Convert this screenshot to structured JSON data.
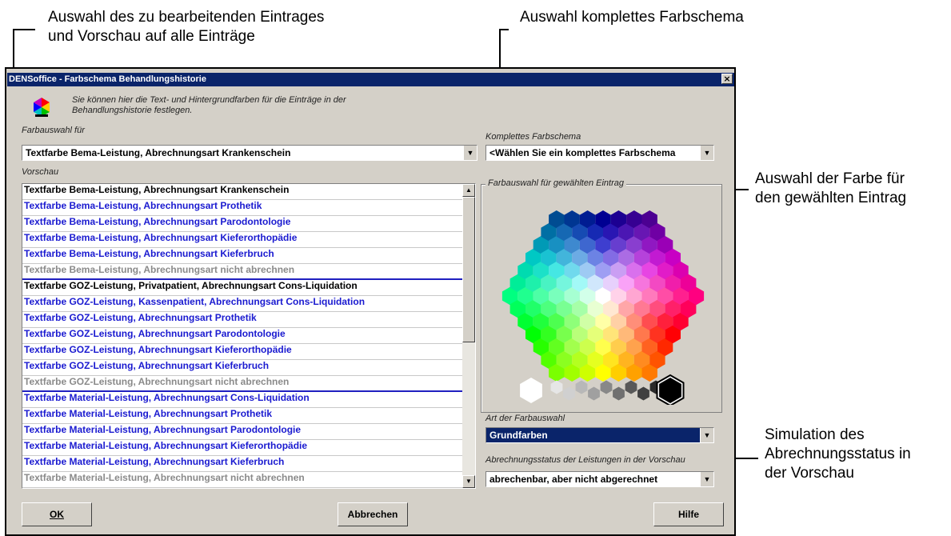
{
  "annotations": {
    "a1_line1": "Auswahl des zu bearbeitenden Eintrages",
    "a1_line2": "und Vorschau auf alle Einträge",
    "a2": "Auswahl komplettes Farbschema",
    "a3_line1": "Auswahl der Farbe für",
    "a3_line2": "den gewählten Eintrag",
    "a4_line1": "Simulation des",
    "a4_line2": "Abrechnungsstatus in",
    "a4_line3": "der Vorschau"
  },
  "window": {
    "title": "DENSoffice - Farbschema Behandlungshistorie",
    "close_label": "×",
    "info_line1": "Sie können hier die Text- und Hintergrundfarben für die Einträge in der",
    "info_line2": "Behandlungshistorie festlegen.",
    "icon": "color-wheel-icon"
  },
  "farbauswahl": {
    "label": "Farbauswahl für",
    "value": "Textfarbe Bema-Leistung, Abrechnungsart Krankenschein"
  },
  "farbschema": {
    "label": "Komplettes Farbschema",
    "value": "<Wählen Sie ein komplettes Farbschema"
  },
  "vorschau": {
    "label": "Vorschau",
    "items": [
      {
        "text": "Textfarbe Bema-Leistung, Abrechnungsart Krankenschein",
        "color": "#000000"
      },
      {
        "text": "Textfarbe Bema-Leistung, Abrechnungsart Prothetik",
        "color": "#1a1ad0"
      },
      {
        "text": "Textfarbe Bema-Leistung, Abrechnungsart Parodontologie",
        "color": "#1a1ad0"
      },
      {
        "text": "Textfarbe Bema-Leistung, Abrechnungsart Kieferorthopädie",
        "color": "#1a1ad0"
      },
      {
        "text": "Textfarbe Bema-Leistung, Abrechnungsart Kieferbruch",
        "color": "#1a1ad0"
      },
      {
        "text": "Textfarbe Bema-Leistung, Abrechnungsart nicht abrechnen",
        "color": "#8a8a8a"
      },
      {
        "text": "Textfarbe GOZ-Leistung, Privatpatient, Abrechnungsart Cons-Liquidation",
        "color": "#000000"
      },
      {
        "text": "Textfarbe GOZ-Leistung, Kassenpatient, Abrechnungsart Cons-Liquidation",
        "color": "#1a1ad0"
      },
      {
        "text": "Textfarbe GOZ-Leistung, Abrechnungsart Prothetik",
        "color": "#1a1ad0"
      },
      {
        "text": "Textfarbe GOZ-Leistung, Abrechnungsart Parodontologie",
        "color": "#1a1ad0"
      },
      {
        "text": "Textfarbe GOZ-Leistung, Abrechnungsart Kieferorthopädie",
        "color": "#1a1ad0"
      },
      {
        "text": "Textfarbe GOZ-Leistung, Abrechnungsart Kieferbruch",
        "color": "#1a1ad0"
      },
      {
        "text": "Textfarbe GOZ-Leistung, Abrechnungsart nicht abrechnen",
        "color": "#8a8a8a"
      },
      {
        "text": "Textfarbe Material-Leistung, Abrechnungsart Cons-Liquidation",
        "color": "#1a1ad0"
      },
      {
        "text": "Textfarbe Material-Leistung, Abrechnungsart Prothetik",
        "color": "#1a1ad0"
      },
      {
        "text": "Textfarbe Material-Leistung, Abrechnungsart Parodontologie",
        "color": "#1a1ad0"
      },
      {
        "text": "Textfarbe Material-Leistung, Abrechnungsart Kieferorthopädie",
        "color": "#1a1ad0"
      },
      {
        "text": "Textfarbe Material-Leistung, Abrechnungsart Kieferbruch",
        "color": "#1a1ad0"
      },
      {
        "text": "Textfarbe Material-Leistung, Abrechnungsart nicht abrechnen",
        "color": "#8a8a8a"
      }
    ]
  },
  "colorpicker": {
    "label": "Farbauswahl für gewählten Eintrag",
    "selected": "black"
  },
  "art": {
    "label": "Art der Farbauswahl",
    "value": "Grundfarben"
  },
  "abrechnung": {
    "label": "Abrechnungsstatus der Leistungen in der Vorschau",
    "value": "abrechenbar, aber nicht abgerechnet"
  },
  "buttons": {
    "ok": "OK",
    "cancel": "Abbrechen",
    "help": "Hilfe"
  },
  "colors": {
    "titlebar": "#0a246a",
    "dialog_bg": "#d4d0c8",
    "blue_text": "#1a1ad0",
    "gray_text": "#8a8a8a",
    "selection": "#0a246a"
  }
}
